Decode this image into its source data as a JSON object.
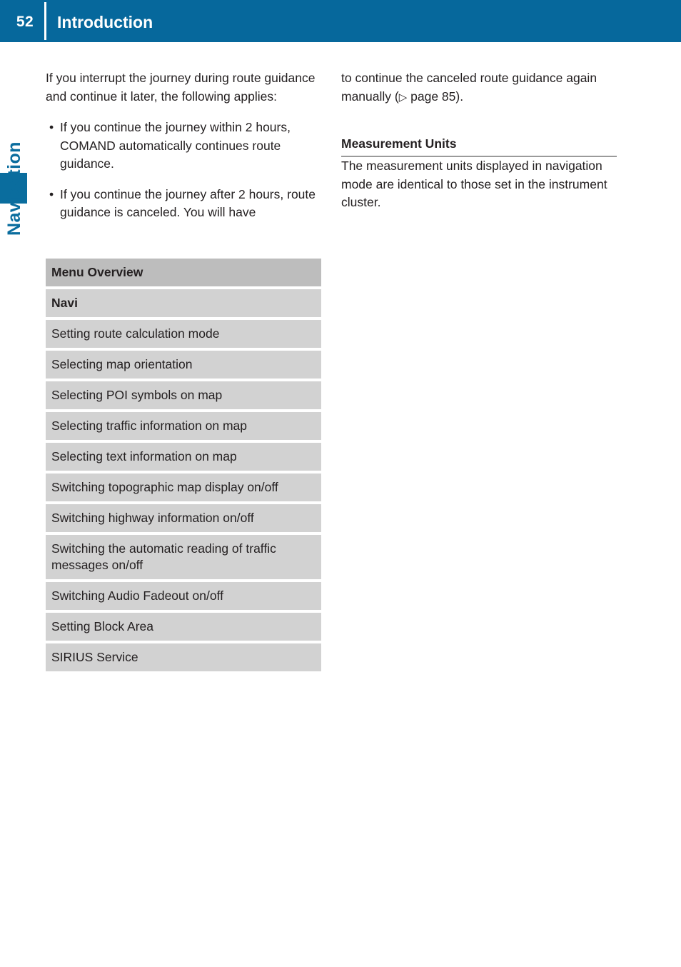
{
  "header": {
    "page_number": "52",
    "title": "Introduction"
  },
  "margin": {
    "chapter_label": "Navigation"
  },
  "left_column": {
    "intro_paragraph": "If you interrupt the journey during route guidance and continue it later, the following applies:",
    "bullet_marker": "•",
    "bullets": [
      "If you continue the journey within 2 hours, COMAND automatically continues route guidance.",
      "If you continue the journey after 2 hours, route guidance is canceled. You will have"
    ]
  },
  "right_column": {
    "continued_text_before_xref": "to continue the canceled route guidance again manually (",
    "xref_icon": "▷",
    "xref_text": " page 85).",
    "section_heading": "Measurement Units",
    "section_paragraph": "The measurement units displayed in navigation mode are identical to those set in the instrument cluster."
  },
  "menu_table": {
    "header": "Menu Overview",
    "subhead": "Navi",
    "rows": [
      "Setting route calculation mode",
      "Selecting map orientation",
      "Selecting POI symbols on map",
      "Selecting traffic information on map",
      "Selecting text information on map",
      "Switching topographic map display on/off",
      "Switching highway information on/off",
      "Switching the automatic reading of traffic messages on/off",
      "Switching Audio Fadeout on/off",
      "Setting Block Area",
      "SIRIUS Service"
    ]
  },
  "colors": {
    "header_blue": "#06689c",
    "tab_blue": "#0a6d9e",
    "table_header_gray": "#bdbdbd",
    "table_row_gray": "#d2d2d2",
    "text_black": "#231f20"
  }
}
